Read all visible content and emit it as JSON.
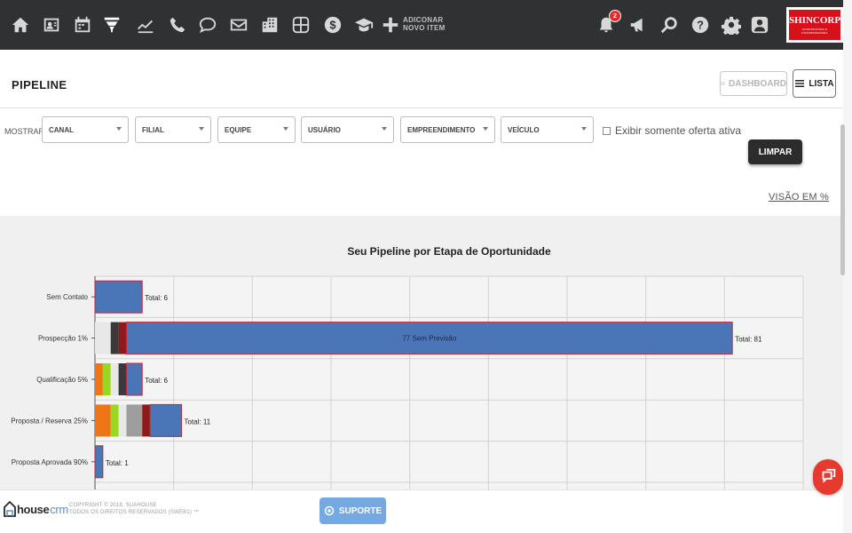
{
  "nav": {
    "items": [
      {
        "name": "home-icon"
      },
      {
        "name": "contacts-icon"
      },
      {
        "name": "calendar-icon"
      },
      {
        "name": "funnel-icon"
      },
      {
        "name": "chart-line-icon"
      },
      {
        "name": "phone-icon"
      },
      {
        "name": "chat-bubble-icon"
      },
      {
        "name": "mail-icon"
      },
      {
        "name": "building-icon"
      },
      {
        "name": "grid-icon"
      },
      {
        "name": "dollar-icon"
      },
      {
        "name": "graduation-cap-icon"
      },
      {
        "name": "plus-icon"
      }
    ],
    "add_item_line1": "ADICONAR",
    "add_item_line2": "NOVO ITEM",
    "notification_count": "2",
    "right_icons": [
      "bell-icon",
      "megaphone-icon",
      "search-icon",
      "help-icon",
      "gear-icon",
      "user-icon"
    ],
    "brand": "SHINCORP",
    "brand_sub": "CONSTRUTORA E INCORPORADORA"
  },
  "header": {
    "title": "PIPELINE",
    "dashboard_label": "DASHBOARD",
    "lista_label": "LISTA"
  },
  "filters": {
    "label": "MOSTRAR",
    "selects": [
      {
        "value": "CANAL"
      },
      {
        "value": "FILIAL"
      },
      {
        "value": "EQUIPE"
      },
      {
        "value": "USUÁRIO"
      },
      {
        "value": "EMPREENDIMENTO"
      },
      {
        "value": "VEÍCULO"
      }
    ],
    "checkbox_label": "Exibir somente oferta ativa",
    "clear_label": "LIMPAR",
    "percent_view_label": "VISÃO EM %"
  },
  "chart_data": {
    "type": "bar",
    "orientation": "horizontal",
    "stacked": true,
    "title": "Seu Pipeline por Etapa de Oportunidade",
    "categories": [
      "Sem Contato",
      "Prospecção 1%",
      "Qualificação 5%",
      "Proposta / Reserva 25%",
      "Proposta Aprovada 90%"
    ],
    "xlim": [
      0,
      90
    ],
    "grid": true,
    "segment_colors": [
      "#f07516",
      "#9ad71f",
      "#e8e8e8",
      "#9e9e9e",
      "#3a3a3a",
      "#8a1c1c",
      "#4a76b8"
    ],
    "stacks": [
      {
        "category": "Sem Contato",
        "segments": [
          {
            "value": 6,
            "color": "#4a76b8"
          }
        ],
        "total_label": "Total: 6"
      },
      {
        "category": "Prospecção 1%",
        "segments": [
          {
            "value": 2,
            "color": "#e8e8e8"
          },
          {
            "value": 1,
            "color": "#3a3a3a"
          },
          {
            "value": 1,
            "color": "#8a1c1c"
          },
          {
            "value": 77,
            "color": "#4a76b8",
            "label": "77 Sem Previsão"
          }
        ],
        "total_label": "Total: 81"
      },
      {
        "category": "Qualificação 5%",
        "segments": [
          {
            "value": 1,
            "color": "#f07516"
          },
          {
            "value": 1,
            "color": "#9ad71f"
          },
          {
            "value": 1,
            "color": "#e8e8e8"
          },
          {
            "value": 1,
            "color": "#3a3a3a"
          },
          {
            "value": 2,
            "color": "#4a76b8"
          }
        ],
        "total_label": "Total: 6"
      },
      {
        "category": "Proposta / Reserva 25%",
        "segments": [
          {
            "value": 2,
            "color": "#f07516"
          },
          {
            "value": 1,
            "color": "#9ad71f"
          },
          {
            "value": 1,
            "color": "#e8e8e8"
          },
          {
            "value": 2,
            "color": "#9e9e9e"
          },
          {
            "value": 1,
            "color": "#8a1c1c"
          },
          {
            "value": 4,
            "color": "#4a76b8"
          }
        ],
        "total_label": "Total: 11"
      },
      {
        "category": "Proposta Aprovada 90%",
        "segments": [
          {
            "value": 1,
            "color": "#4a76b8"
          }
        ],
        "total_label": "Total: 1"
      }
    ]
  },
  "footer": {
    "logo_house": "house",
    "logo_crm": "crm",
    "copyright_line1": "COPYRIGHT © 2018, SUAHOUSE",
    "copyright_line2": "TODOS OS DIREITOS RESERVADOS (SWEB1) ™",
    "support_label": "SUPORTE"
  }
}
